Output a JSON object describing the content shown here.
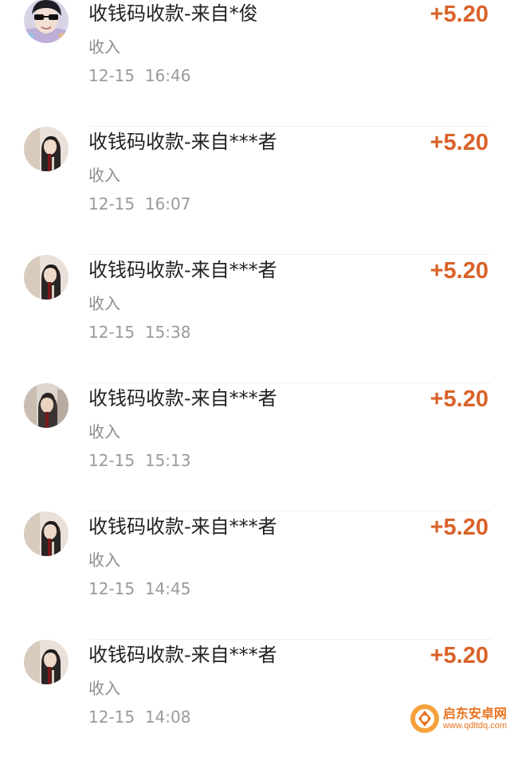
{
  "transactions": [
    {
      "title": "收钱码收款-来自*俊",
      "type": "收入",
      "time": "12-15  16:46",
      "amount": "+5.20",
      "avatar": "avatar-sunglasses-icon"
    },
    {
      "title": "收钱码收款-来自***者",
      "type": "收入",
      "time": "12-15  16:07",
      "amount": "+5.20",
      "avatar": "avatar-portrait-icon"
    },
    {
      "title": "收钱码收款-来自***者",
      "type": "收入",
      "time": "12-15  15:38",
      "amount": "+5.20",
      "avatar": "avatar-portrait-icon"
    },
    {
      "title": "收钱码收款-来自***者",
      "type": "收入",
      "time": "12-15  15:13",
      "amount": "+5.20",
      "avatar": "avatar-portrait-icon"
    },
    {
      "title": "收钱码收款-来自***者",
      "type": "收入",
      "time": "12-15  14:45",
      "amount": "+5.20",
      "avatar": "avatar-portrait-icon"
    },
    {
      "title": "收钱码收款-来自***者",
      "type": "收入",
      "time": "12-15  14:08",
      "amount": "+5.20",
      "avatar": "avatar-portrait-icon"
    }
  ],
  "watermark": {
    "title": "启东安卓网",
    "url": "www.qdltdq.com"
  },
  "colors": {
    "amount": "#d9622a",
    "title_text": "#222222",
    "secondary_text": "#8e8e8e",
    "watermark": "#e8731f"
  }
}
